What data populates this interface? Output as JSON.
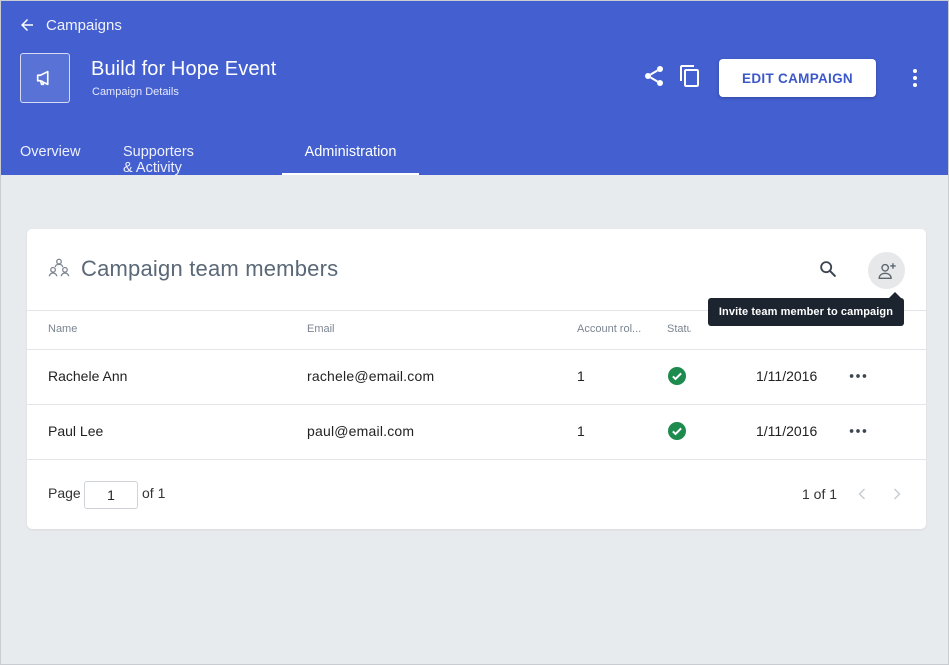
{
  "header": {
    "back_label": "Campaigns",
    "campaign_title": "Build for Hope Event",
    "campaign_subtitle": "Campaign Details",
    "edit_label": "EDIT CAMPAIGN",
    "brand_color": "#435fd0"
  },
  "tabs": [
    {
      "label": "Overview",
      "active": false
    },
    {
      "label": "Supporters & Activity",
      "active": false
    },
    {
      "label": "Administration",
      "active": true
    }
  ],
  "team_card": {
    "title": "Campaign team members",
    "tooltip": "Invite team member to campaign",
    "columns": [
      "Name",
      "Email",
      "Account rol...",
      "Statu"
    ],
    "rows": [
      {
        "name": "Rachele Ann",
        "email": "rachele@email.com",
        "role": "1",
        "status": "active",
        "date": "1/11/2016"
      },
      {
        "name": "Paul Lee",
        "email": "paul@email.com",
        "role": "1",
        "status": "active",
        "date": "1/11/2016"
      }
    ],
    "pager": {
      "page_label": "Page",
      "page_value": "1",
      "of_label": "of 1",
      "count_label": "1 of 1"
    }
  },
  "icons": {
    "back": "arrow-left-icon",
    "campaign": "megaphone-icon",
    "share": "share-icon",
    "copy": "copy-icon",
    "more": "more-vertical-icon",
    "team": "team-icon",
    "search": "search-icon",
    "invite": "add-person-icon",
    "status": "check-circle-icon",
    "row_more": "more-horizontal-icon"
  },
  "colors": {
    "status_ok": "#1e8b4e",
    "page_bg": "#e8ebee"
  }
}
